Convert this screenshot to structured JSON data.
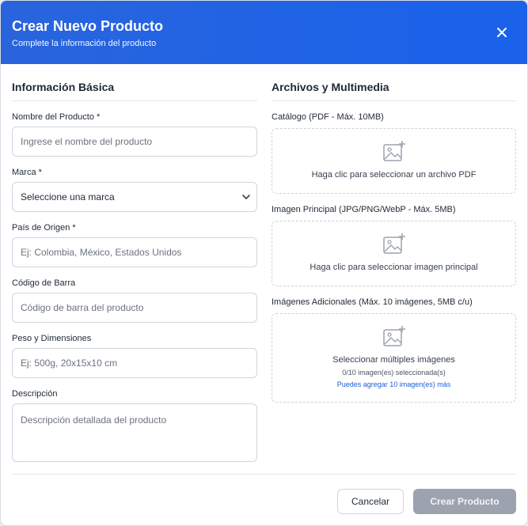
{
  "header": {
    "title": "Crear Nuevo Producto",
    "subtitle": "Complete la información del producto"
  },
  "basic": {
    "section_title": "Información Básica",
    "name_label": "Nombre del Producto *",
    "name_placeholder": "Ingrese el nombre del producto",
    "brand_label": "Marca *",
    "brand_selected": "Seleccione una marca",
    "country_label": "País de Origen *",
    "country_placeholder": "Ej: Colombia, México, Estados Unidos",
    "barcode_label": "Código de Barra",
    "barcode_placeholder": "Código de barra del producto",
    "weight_label": "Peso y Dimensiones",
    "weight_placeholder": "Ej: 500g, 20x15x10 cm",
    "description_label": "Descripción",
    "description_placeholder": "Descripción detallada del producto"
  },
  "media": {
    "section_title": "Archivos y Multimedia",
    "catalog_label": "Catálogo (PDF - Máx. 10MB)",
    "catalog_text": "Haga clic para seleccionar un archivo PDF",
    "main_image_label": "Imagen Principal (JPG/PNG/WebP - Máx. 5MB)",
    "main_image_text": "Haga clic para seleccionar imagen principal",
    "extra_label": "Imágenes Adicionales (Máx. 10 imágenes, 5MB c/u)",
    "extra_text": "Seleccionar múltiples imágenes",
    "extra_count": "0/10 imagen(es) seleccionada(s)",
    "extra_hint": "Puedes agregar 10 imagen(es) más"
  },
  "footer": {
    "cancel_label": "Cancelar",
    "create_label": "Crear Producto"
  },
  "colors": {
    "header_bg": "#1f63e6",
    "link": "#1d5fd6",
    "disabled_button": "#9ca3af"
  },
  "icons": {
    "close": "close-icon",
    "chevron": "chevron-down-icon",
    "image_add": "image-add-icon"
  }
}
